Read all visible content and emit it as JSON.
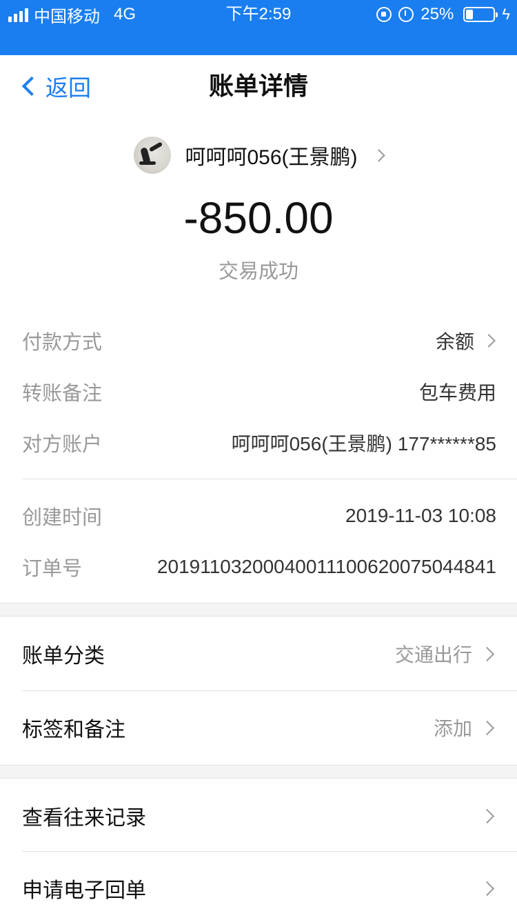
{
  "status_bar": {
    "carrier": "中国移动",
    "network": "4G",
    "time": "下午2:59",
    "battery": "25%",
    "battery_level": 0.25,
    "icons": [
      "signal-icon",
      "rotation-lock-icon",
      "alarm-icon",
      "battery-icon",
      "charging-icon"
    ]
  },
  "nav": {
    "back_label": "返回",
    "title": "账单详情"
  },
  "header": {
    "payee_name": "呵呵呵056(王景鹏)",
    "amount": "-850.00",
    "status": "交易成功"
  },
  "details": [
    {
      "label": "付款方式",
      "value": "余额",
      "has_chevron": true
    },
    {
      "label": "转账备注",
      "value": "包车费用"
    },
    {
      "label": "对方账户",
      "value": "呵呵呵056(王景鹏) 177******85"
    },
    {
      "label": "创建时间",
      "value": "2019-11-03 10:08"
    },
    {
      "label": "订单号",
      "value": "20191103200040011100620075044841"
    }
  ],
  "section_one": [
    {
      "label": "账单分类",
      "value": "交通出行"
    },
    {
      "label": "标签和备注",
      "value": "添加"
    }
  ],
  "section_two": [
    {
      "label": "查看往来记录",
      "value": ""
    },
    {
      "label": "申请电子回单",
      "value": ""
    }
  ],
  "colors": {
    "accent": "#1a7ef0",
    "muted": "#999999",
    "band": "#f4f4f5"
  }
}
